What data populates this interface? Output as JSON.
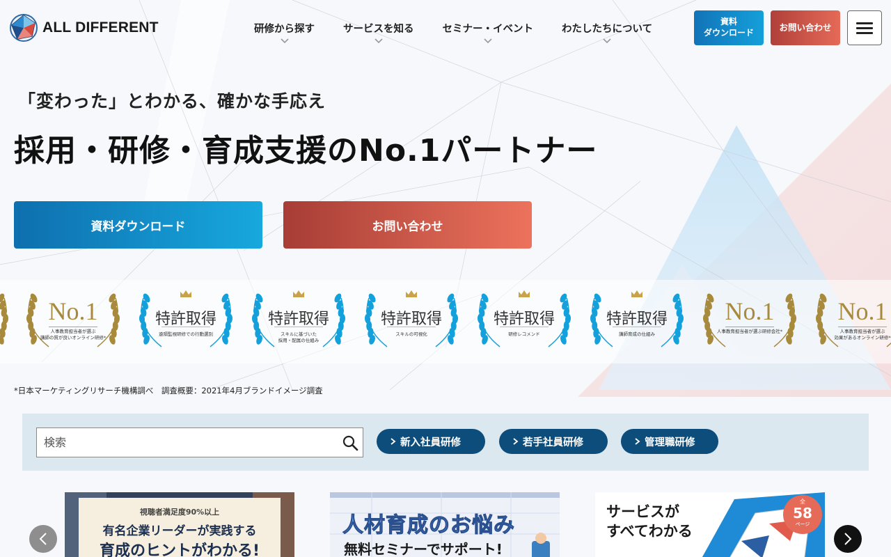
{
  "header": {
    "logo_text": "ALL DIFFERENT",
    "nav": [
      {
        "label": "研修から探す"
      },
      {
        "label": "サービスを知る"
      },
      {
        "label": "セミナー・イベント"
      },
      {
        "label": "わたしたちについて"
      }
    ],
    "download_line1": "資料",
    "download_line2": "ダウンロード",
    "contact_label": "お問い合わせ"
  },
  "hero": {
    "subtitle": "「変わった」とわかる、確かな手応え",
    "title": "採用・研修・育成支援のNo.1パートナー",
    "download_cta": "資料ダウンロード",
    "contact_cta": "お問い合わせ"
  },
  "awards": [
    {
      "kind": "no1",
      "title": "No.1",
      "cap1": "人事教育担当者が選ぶ",
      "cap2": "講師の質が良いオンライン研修*"
    },
    {
      "kind": "patent",
      "title": "特許取得",
      "cap1": "",
      "cap2": "遠隔監視研修での行動選別"
    },
    {
      "kind": "patent",
      "title": "特許取得",
      "cap1": "スキルに基づいた",
      "cap2": "採用・配属の仕組み"
    },
    {
      "kind": "patent",
      "title": "特許取得",
      "cap1": "",
      "cap2": "スキルの可視化"
    },
    {
      "kind": "patent",
      "title": "特許取得",
      "cap1": "",
      "cap2": "研修レコメンド"
    },
    {
      "kind": "patent",
      "title": "特許取得",
      "cap1": "",
      "cap2": "講師育成の仕組み"
    },
    {
      "kind": "no1",
      "title": "No.1",
      "cap1": "",
      "cap2": "人事教育担当者が選ぶ研修会社*"
    },
    {
      "kind": "no1",
      "title": "No.1",
      "cap1": "人事教育担当者が選ぶ",
      "cap2": "効果があるオンライン研修*"
    }
  ],
  "note": "*日本マーケティングリサーチ機構調べ　調査概要：2021年4月ブランドイメージ調査",
  "search": {
    "placeholder": "検索",
    "tags": [
      {
        "label": "新入社員研修"
      },
      {
        "label": "若手社員研修"
      },
      {
        "label": "管理職研修"
      }
    ]
  },
  "carousel": {
    "slide1": {
      "badge": "視聴者満足度90%以上",
      "line1": "有名企業リーダーが実践する",
      "line2": "育成のヒントがわかる!"
    },
    "slide2": {
      "line1": "人材育成のお悩み",
      "line2": "無料セミナーでサポート!"
    },
    "slide3": {
      "line1": "サービスが",
      "line2": "すべてわかる",
      "badge_top": "全",
      "badge_num": "58",
      "badge_unit": "ページ"
    }
  },
  "colors": {
    "brand_blue": "#14a0da",
    "brand_red": "#e56a57",
    "navy": "#0d4d7c",
    "gold": "#a88a3d"
  }
}
